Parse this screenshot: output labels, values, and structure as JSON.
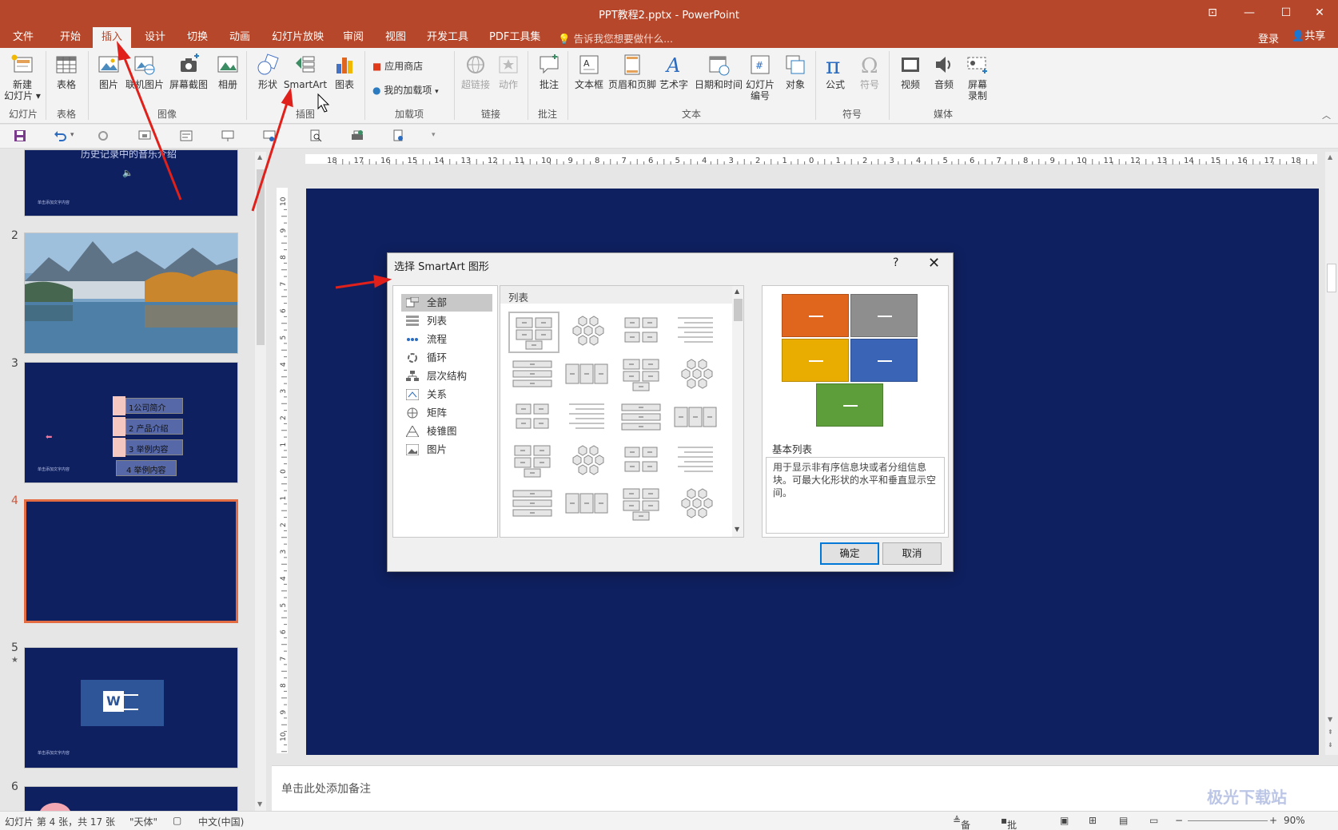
{
  "window": {
    "title": "PPT教程2.pptx - PowerPoint"
  },
  "tabs": [
    "文件",
    "开始",
    "插入",
    "设计",
    "切换",
    "动画",
    "幻灯片放映",
    "审阅",
    "视图",
    "开发工具",
    "PDF工具集"
  ],
  "active_tab": "插入",
  "tellme": "告诉我您想要做什么...",
  "account": {
    "login": "登录",
    "share": "共享"
  },
  "ribbon": {
    "buttons": {
      "new_slide": "新建\n幻灯片 ▾",
      "table": "表格",
      "picture": "图片",
      "online_picture": "联机图片",
      "screenshot": "屏幕截图",
      "album": "相册",
      "shapes": "形状",
      "smartart": "SmartArt",
      "chart": "图表",
      "app_store": "应用商店",
      "my_addins": "我的加载项",
      "hyperlink": "超链接",
      "action": "动作",
      "comment": "批注",
      "textbox": "文本框",
      "header_footer": "页眉和页脚",
      "wordart": "艺术字",
      "date_time": "日期和时间",
      "slide_number": "幻灯片\n编号",
      "object": "对象",
      "equation": "公式",
      "symbol": "符号",
      "video": "视频",
      "audio": "音频",
      "screen_record": "屏幕\n录制"
    },
    "groups": {
      "slides": "幻灯片",
      "tables": "表格",
      "images": "图像",
      "illustrations": "插图",
      "addins": "加载项",
      "links": "链接",
      "comments": "批注",
      "text": "文本",
      "symbols": "符号",
      "media": "媒体"
    }
  },
  "slides": [
    {
      "num": "",
      "title": "历史记录中的音乐介绍",
      "footer": "单击添加文字内容"
    },
    {
      "num": "2"
    },
    {
      "num": "3",
      "items": [
        "1公司简介",
        "2 产品介绍",
        "3 举例内容",
        "4 举例内容"
      ],
      "footer": "单击添加文字内容"
    },
    {
      "num": "4"
    },
    {
      "num": "5",
      "star": "★",
      "footer": "单击添加文字内容"
    },
    {
      "num": "6"
    }
  ],
  "notes_placeholder": "单击此处添加备注",
  "status": {
    "slide_info": "幻灯片 第 4 张，共 17 张",
    "theme": "\"天体\"",
    "language": "中文(中国)",
    "notes": "备注",
    "comments": "批注",
    "zoom": "90%"
  },
  "dialog": {
    "title": "选择 SmartArt 图形",
    "help": "?",
    "categories": [
      "全部",
      "列表",
      "流程",
      "循环",
      "层次结构",
      "关系",
      "矩阵",
      "棱锥图",
      "图片"
    ],
    "selected_category": "全部",
    "section_header": "列表",
    "preview_name": "基本列表",
    "preview_desc": "用于显示非有序信息块或者分组信息块。可最大化形状的水平和垂直显示空间。",
    "preview_colors": [
      "#e0661e",
      "#8e8e8e",
      "#e8ad00",
      "#3a64b5",
      "#5e9e3a"
    ],
    "ok": "确定",
    "cancel": "取消"
  },
  "watermark": "极光下载站",
  "colors": {
    "accent": "#b7472a",
    "slide_bg": "#0f2060",
    "arrow": "#e0201b"
  }
}
